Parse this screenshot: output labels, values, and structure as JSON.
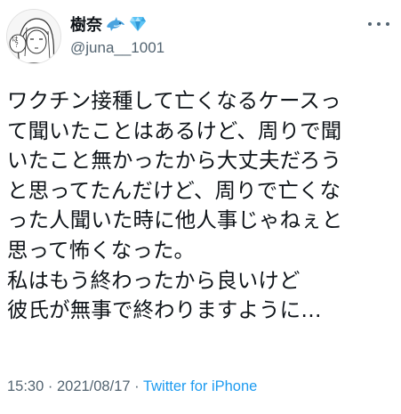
{
  "author": {
    "display_name": "樹奈",
    "handle": "@juna__1001",
    "name_emojis": [
      "dolphin-icon",
      "gem-icon"
    ],
    "avatar_text": "は？"
  },
  "tweet": {
    "lines": [
      "ワクチン接種して亡くなるケースっ",
      "て聞いたことはあるけど、周りで聞",
      "いたこと無かったから大丈夫だろう",
      "と思ってたんだけど、周りで亡くな",
      "った人聞いた時に他人事じゃねぇと",
      "思って怖くなった。",
      "私はもう終わったから良いけど",
      "彼氏が無事で終わりますように…"
    ]
  },
  "meta": {
    "time": "15:30",
    "separator1": " · ",
    "date": "2021/08/17",
    "separator2": " · ",
    "source": "Twitter for iPhone"
  },
  "colors": {
    "text": "#0f1419",
    "secondary": "#536471",
    "link": "#1d9bf0"
  }
}
